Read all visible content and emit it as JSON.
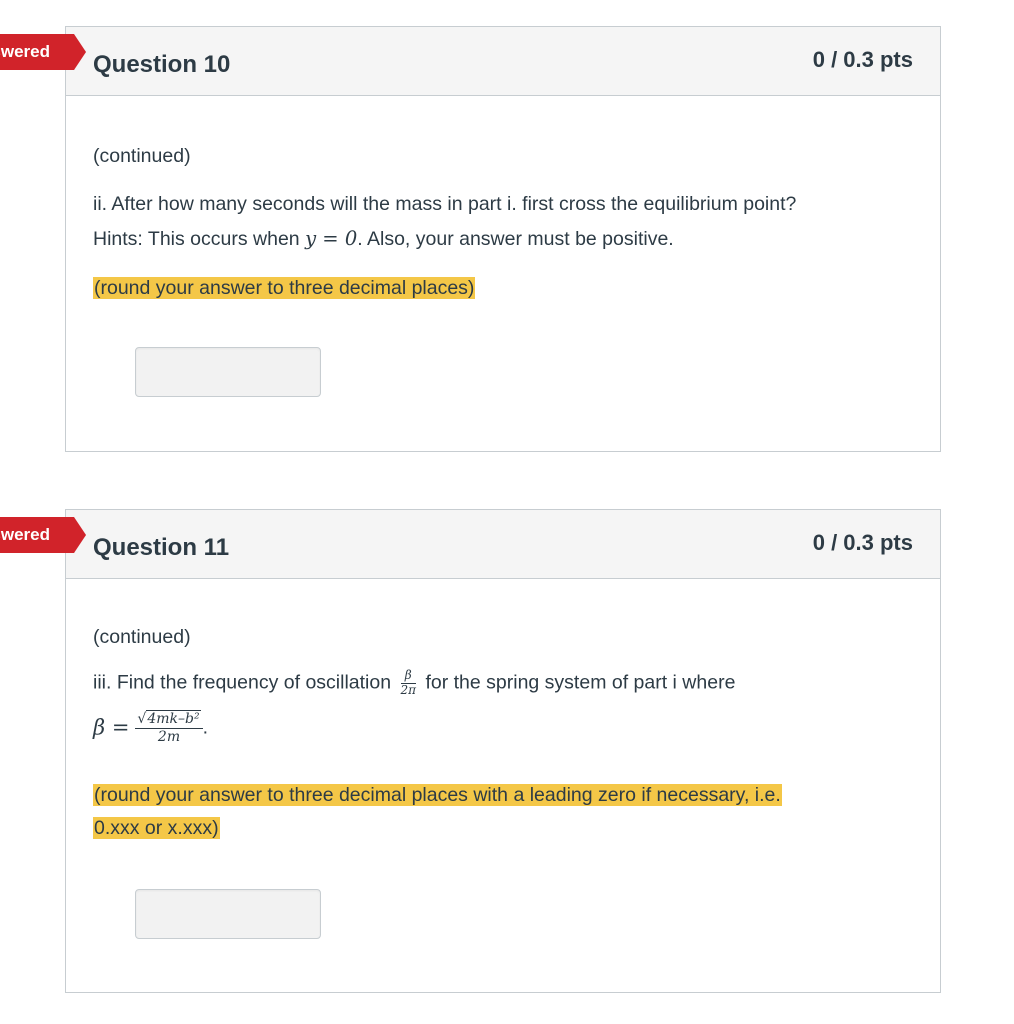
{
  "questions": [
    {
      "flag": "Unanswered",
      "title": "Question 10",
      "points": "0 / 0.3 pts",
      "continued": "(continued)",
      "line1": "ii. After how many seconds will the mass in part i. first cross the equilibrium point?",
      "line2_pre": "Hints: This occurs when ",
      "line2_math": "y = 0",
      "line2_post": ".  Also, your answer must be positive.",
      "highlight": "(round your answer to three decimal places)"
    },
    {
      "flag": "Unanswered",
      "title": "Question 11",
      "points": "0 / 0.3 pts",
      "continued": "(continued)",
      "line1_pre": "iii. Find the frequency of oscillation ",
      "frac_num": "β",
      "frac_den": "2π",
      "line1_post": " for the spring system of part i where",
      "beta_lhs": "β =",
      "beta_num_radicand": "4mk–b²",
      "beta_den": "2m",
      "highlight_line1": "(round your answer to three decimal places with a leading zero if necessary, i.e.",
      "highlight_line2": "0.xxx or x.xxx)"
    }
  ]
}
